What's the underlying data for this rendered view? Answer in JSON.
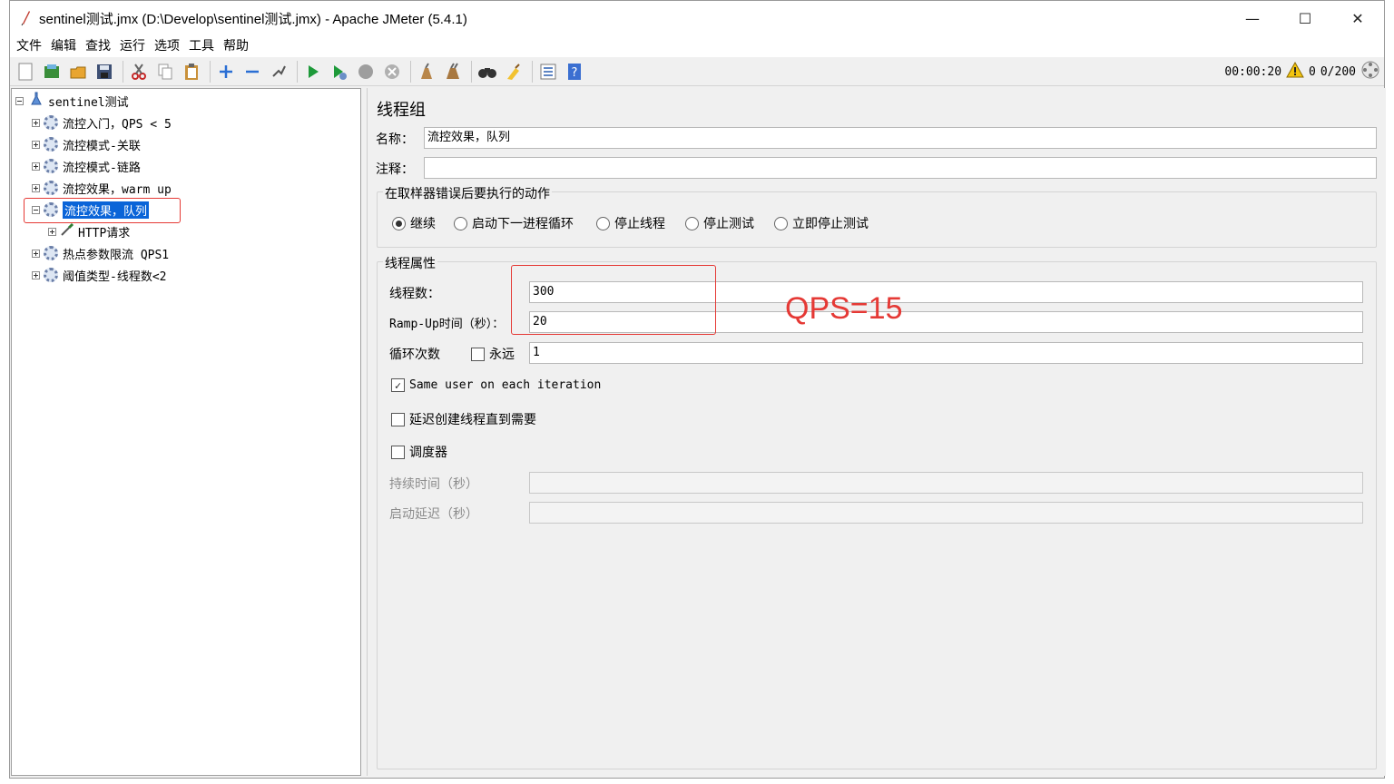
{
  "window": {
    "title": "sentinel测试.jmx (D:\\Develop\\sentinel测试.jmx) - Apache JMeter (5.4.1)",
    "controls": {
      "minimize": "—",
      "maximize": "☐",
      "close": "✕"
    }
  },
  "menu": [
    "文件",
    "编辑",
    "查找",
    "运行",
    "选项",
    "工具",
    "帮助"
  ],
  "toolbar": {
    "icons": [
      "new-icon",
      "templates-icon",
      "open-icon",
      "save-icon",
      "cut-icon",
      "copy-icon",
      "paste-icon",
      "expand-icon",
      "collapse-icon",
      "toggle-icon",
      "start-icon",
      "start-no-pause-icon",
      "stop-icon",
      "shutdown-icon",
      "clear-icon",
      "clear-all-icon",
      "search-icon",
      "reset-search-icon",
      "function-helper-icon",
      "help-icon"
    ],
    "timer": "00:00:20",
    "warning_count": "0",
    "threads": "0/200"
  },
  "tree": {
    "root": "sentinel测试",
    "items": [
      {
        "label": "流控入门，QPS < 5"
      },
      {
        "label": "流控模式-关联"
      },
      {
        "label": "流控模式-链路"
      },
      {
        "label": "流控效果，warm up"
      },
      {
        "label": "流控效果，队列",
        "selected": true
      },
      {
        "label": "HTTP请求",
        "child": true
      },
      {
        "label": "热点参数限流 QPS1"
      },
      {
        "label": "阈值类型-线程数<2"
      }
    ]
  },
  "panel": {
    "title": "线程组",
    "name_label": "名称：",
    "name_value": "流控效果，队列",
    "comment_label": "注释：",
    "comment_value": "",
    "error_group_title": "在取样器错误后要执行的动作",
    "error_options": [
      "继续",
      "启动下一进程循环",
      "停止线程",
      "停止测试",
      "立即停止测试"
    ],
    "error_selected": "继续",
    "thread_props_title": "线程属性",
    "threads_label": "线程数：",
    "threads_value": "300",
    "rampup_label": "Ramp-Up时间（秒）：",
    "rampup_value": "20",
    "loop_label": "循环次数",
    "forever_label": "永远",
    "forever_checked": false,
    "loop_value": "1",
    "same_user_label": "Same user on each iteration",
    "same_user_checked": true,
    "delay_label": "延迟创建线程直到需要",
    "delay_checked": false,
    "scheduler_label": "调度器",
    "scheduler_checked": false,
    "duration_label": "持续时间（秒）",
    "duration_value": "",
    "startup_delay_label": "启动延迟（秒）",
    "startup_delay_value": ""
  },
  "annotation": {
    "text": "QPS=15",
    "color": "#e53935"
  }
}
